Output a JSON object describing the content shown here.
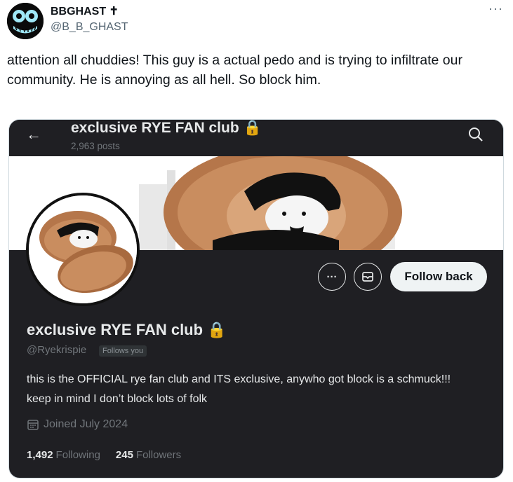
{
  "tweet": {
    "author_name": "BBGHAST ✝",
    "handle": "@B_B_GHAST",
    "more_label": "···",
    "text": "attention all chuddies! This guy is a actual pedo and is trying to infiltrate our community. He is annoying as all hell. So block him."
  },
  "profile": {
    "top_title": "exclusive RYE FAN club 🔒",
    "posts_count": "2,963 posts",
    "name": "exclusive RYE FAN club 🔒",
    "handle": "@Ryekrispie",
    "follows_you": "Follows you",
    "bio": "this is the OFFICIAL rye fan club and ITS exclusive, anywho got block is a schmuck!!! keep in mind I don’t block lots of folk",
    "joined": "Joined July 2024",
    "following_count": "1,492",
    "following_label": "Following",
    "followers_count": "245",
    "followers_label": "Followers",
    "follow_back_label": "Follow back",
    "more_dots": "···"
  },
  "icons": [
    "back-arrow-icon",
    "search-icon",
    "more-icon",
    "message-icon",
    "calendar-icon",
    "lock-icon",
    "cross-icon"
  ],
  "colors": {
    "card_bg": "#1f1f23",
    "text_dark": "#0f1419",
    "muted": "#536471",
    "dark_muted": "#71767b",
    "button_light": "#eff3f4"
  }
}
